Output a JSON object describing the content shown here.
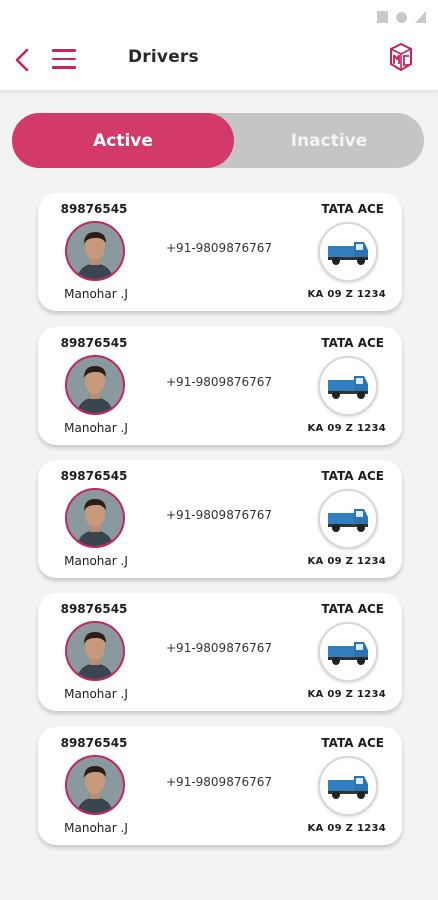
{
  "header": {
    "title": "Drivers",
    "back_icon": "chevron-left-icon",
    "menu_icon": "hamburger-menu-icon",
    "logo_icon": "brand-logo-icon"
  },
  "tabs": {
    "active_label": "Active",
    "inactive_label": "Inactive"
  },
  "colors": {
    "accent": "#c8235f",
    "active_tab": "#d33a69",
    "inactive_tab": "#c5c5c5"
  },
  "drivers": [
    {
      "id": "89876545",
      "name": "Manohar .J",
      "phone": "+91-9809876767",
      "vehicle_model": "TATA ACE",
      "plate": "KA 09 Z 1234"
    },
    {
      "id": "89876545",
      "name": "Manohar .J",
      "phone": "+91-9809876767",
      "vehicle_model": "TATA ACE",
      "plate": "KA 09 Z 1234"
    },
    {
      "id": "89876545",
      "name": "Manohar .J",
      "phone": "+91-9809876767",
      "vehicle_model": "TATA ACE",
      "plate": "KA 09 Z 1234"
    },
    {
      "id": "89876545",
      "name": "Manohar .J",
      "phone": "+91-9809876767",
      "vehicle_model": "TATA ACE",
      "plate": "KA 09 Z 1234"
    },
    {
      "id": "89876545",
      "name": "Manohar .J",
      "phone": "+91-9809876767",
      "vehicle_model": "TATA ACE",
      "plate": "KA 09 Z 1234"
    }
  ]
}
